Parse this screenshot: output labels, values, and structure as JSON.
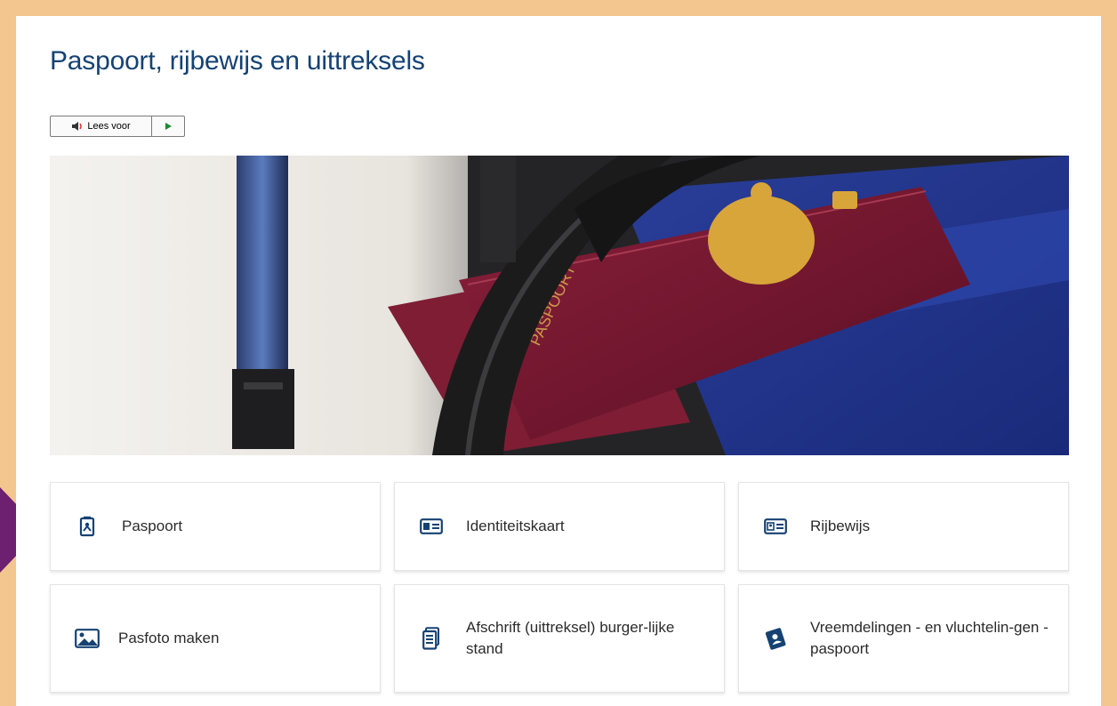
{
  "page": {
    "title": "Paspoort, rijbewijs en uittreksels"
  },
  "readspeaker": {
    "label": "Lees voor",
    "speaker_icon": "speaker-icon",
    "play_icon": "play-icon"
  },
  "hero": {
    "image": "passport-on-suitcase-photo"
  },
  "tiles": [
    {
      "label": "Paspoort",
      "icon": "passport-icon"
    },
    {
      "label": "Identiteitskaart",
      "icon": "id-card-icon"
    },
    {
      "label": "Rijbewijs",
      "icon": "driving-license-icon"
    },
    {
      "label": "Pasfoto maken",
      "icon": "photo-icon"
    },
    {
      "label": "Afschrift (uittreksel) burger-lijke stand",
      "icon": "document-icon"
    },
    {
      "label": "Vreemdelingen - en vluchtelin-gen -paspoort",
      "icon": "refugee-passport-icon"
    }
  ],
  "colors": {
    "background": "#f3c690",
    "title": "#154273",
    "accent_arrow": "#6d1f70",
    "icon": "#154273"
  }
}
